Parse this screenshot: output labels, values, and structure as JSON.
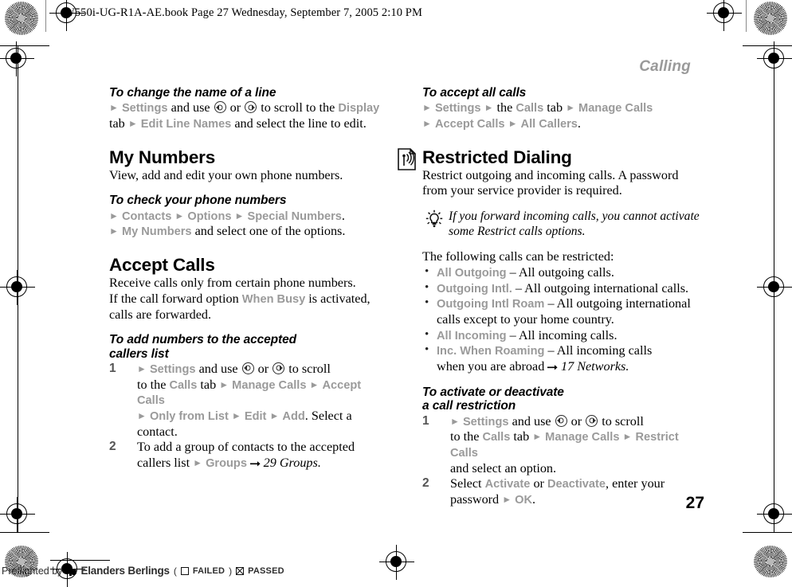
{
  "book_header": "W550i-UG-R1A-AE.book  Page 27  Wednesday, September 7, 2005  2:10 PM",
  "chapter": "Calling",
  "page_number": "27",
  "left_column": {
    "task1": {
      "heading": "To change the name of a line",
      "line1_a": "Settings",
      "line1_b": " and use ",
      "line1_c": " or ",
      "line1_d": " to scroll to the ",
      "line1_e": "Display",
      "line2_a": "tab ",
      "line2_b": "Edit Line Names",
      "line2_c": " and select the line to edit."
    },
    "section_my_numbers": {
      "heading": "My Numbers",
      "intro": "View, add and edit your own phone numbers."
    },
    "task2": {
      "heading": "To check your phone numbers",
      "line1_a": "Contacts",
      "line1_b": "Options",
      "line1_c": "Special Numbers",
      "line2_a": "My Numbers",
      "line2_b": " and select one of the options."
    },
    "section_accept_calls": {
      "heading": "Accept Calls",
      "intro_a": "Receive calls only from certain phone numbers.",
      "intro_b": "If the call forward option ",
      "intro_ui": "When Busy",
      "intro_c": " is activated,",
      "intro_d": "calls are forwarded."
    },
    "task3": {
      "heading_line1": "To add numbers to the accepted",
      "heading_line2": "callers list",
      "step1": {
        "num": "1",
        "a": "Settings",
        "b": " and use ",
        "c": " or ",
        "d": " to scroll",
        "e": "to the ",
        "f": "Calls",
        "g": " tab ",
        "h": "Manage Calls",
        "i": "Accept Calls",
        "j": "Only from List",
        "k": "Edit",
        "l": "Add",
        "m": ". Select a contact."
      },
      "step2": {
        "num": "2",
        "a": "To add a group of contacts to the accepted",
        "b": "callers list ",
        "c": "Groups",
        "xref": "29 Groups."
      }
    }
  },
  "right_column": {
    "task1": {
      "heading": "To accept all calls",
      "line1_a": "Settings",
      "line1_b": " the ",
      "line1_c": "Calls",
      "line1_d": " tab ",
      "line1_e": "Manage Calls",
      "line2_a": "Accept Calls",
      "line2_b": "All Callers",
      "line2_c": "."
    },
    "section_restricted": {
      "icon": "signal-document-icon",
      "heading": "Restricted Dialing",
      "intro_a": "Restrict outgoing and incoming calls. A password",
      "intro_b": "from your service provider is required."
    },
    "tip": {
      "icon": "lightbulb-tip-icon",
      "line1": "If you forward incoming calls, you cannot activate",
      "line2": "some Restrict calls options."
    },
    "restricted_intro": "The following calls can be restricted:",
    "bullets": [
      {
        "term": "All Outgoing",
        "desc": " – All outgoing calls."
      },
      {
        "term": "Outgoing Intl.",
        "desc": " – All outgoing international calls."
      },
      {
        "term": "Outgoing Intl Roam",
        "desc": " – All outgoing international",
        "desc2": "calls except to your home country."
      },
      {
        "term": "All Incoming",
        "desc": " – All incoming calls."
      },
      {
        "term": "Inc. When Roaming",
        "desc": " – All incoming calls",
        "desc2_pre": "when you are abroad ",
        "xref": "17 Networks."
      }
    ],
    "task2": {
      "heading_line1": "To activate or deactivate",
      "heading_line2": "a call restriction",
      "step1": {
        "num": "1",
        "a": "Settings",
        "b": " and use ",
        "c": " or ",
        "d": " to scroll",
        "e": "to the ",
        "f": "Calls",
        "g": " tab ",
        "h": "Manage Calls",
        "i": "Restrict Calls",
        "j": "and select an option."
      },
      "step2": {
        "num": "2",
        "a": "Select ",
        "b": "Activate",
        "c": " or ",
        "d": "Deactivate",
        "e": ", enter your",
        "f": "password ",
        "g": "OK",
        "h": "."
      }
    }
  },
  "footer": {
    "preflight_text": "Preflighted by",
    "brand": "Elanders Berlings",
    "paren_open": "(",
    "failed_label": "FAILED",
    "paren_close": ")",
    "passed_label": "PASSED"
  }
}
